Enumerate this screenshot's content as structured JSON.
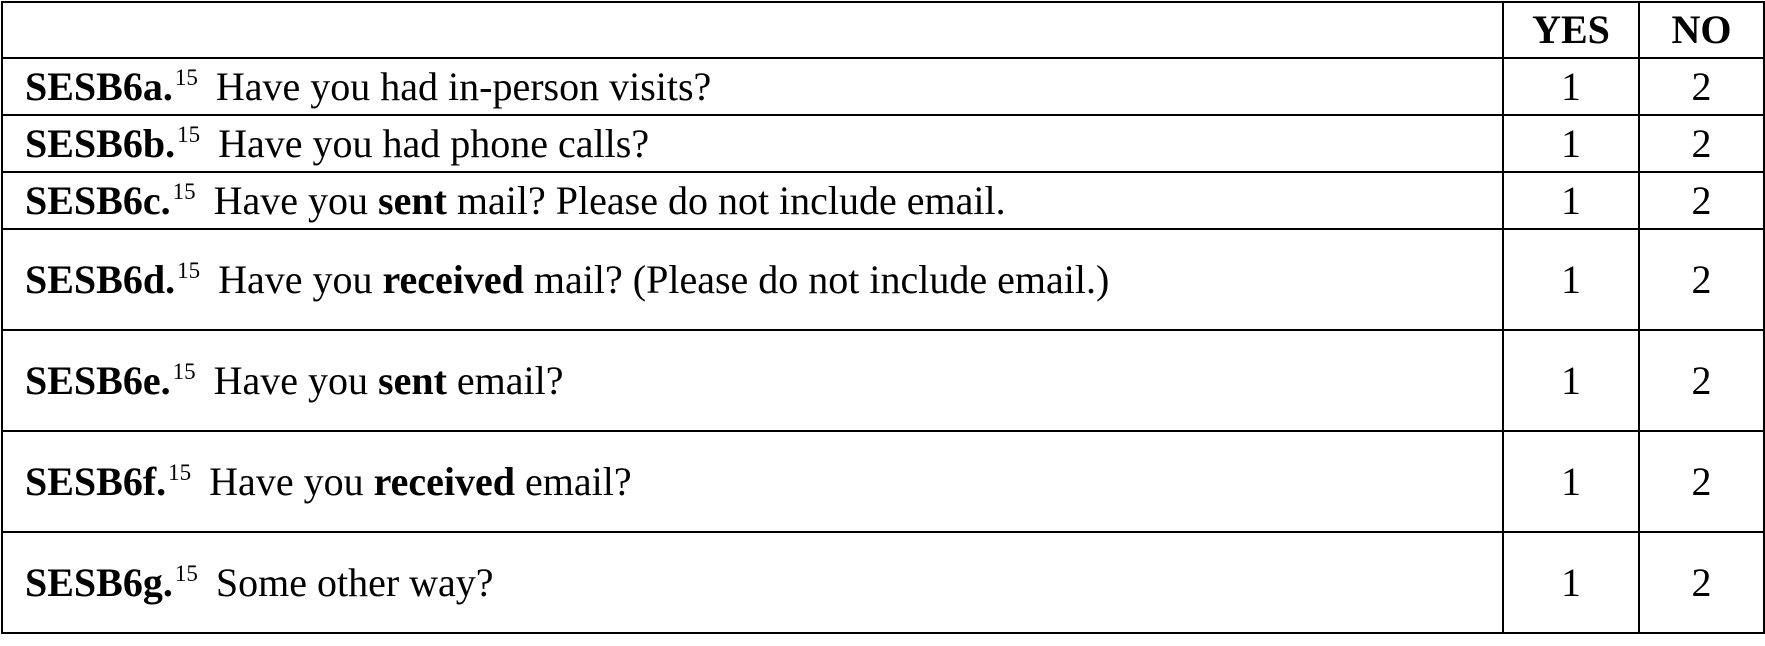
{
  "header": {
    "question_col": "",
    "yes_label": "YES",
    "no_label": "NO"
  },
  "rows": [
    {
      "id": "SESB6a.",
      "footnote": "15",
      "text_before": "Have you had in-person visits?",
      "emphasis": "",
      "text_after": "",
      "yes": "1",
      "no": "2"
    },
    {
      "id": "SESB6b.",
      "footnote": "15",
      "text_before": "Have you had phone calls?",
      "emphasis": "",
      "text_after": "",
      "yes": "1",
      "no": "2"
    },
    {
      "id": "SESB6c.",
      "footnote": "15",
      "text_before": "Have you ",
      "emphasis": "sent",
      "text_after": " mail? Please do not include email.",
      "yes": "1",
      "no": "2"
    },
    {
      "id": "SESB6d.",
      "footnote": "15",
      "text_before": "Have you ",
      "emphasis": "received",
      "text_after": " mail? (Please do not include email.)",
      "yes": "1",
      "no": "2"
    },
    {
      "id": "SESB6e.",
      "footnote": "15",
      "text_before": "Have you ",
      "emphasis": "sent",
      "text_after": " email?",
      "yes": "1",
      "no": "2"
    },
    {
      "id": "SESB6f.",
      "footnote": "15",
      "text_before": "Have you ",
      "emphasis": "received",
      "text_after": " email?",
      "yes": "1",
      "no": "2"
    },
    {
      "id": "SESB6g.",
      "footnote": "15",
      "text_before": "Some other way?",
      "emphasis": "",
      "text_after": "",
      "yes": "1",
      "no": "2"
    }
  ]
}
